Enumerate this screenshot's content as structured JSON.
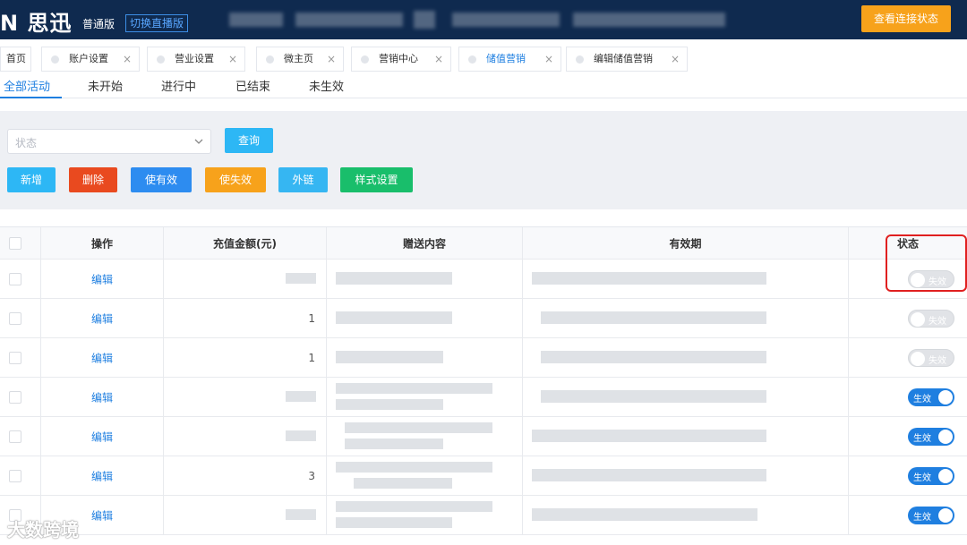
{
  "header": {
    "logo": "N 思迅",
    "edition": "普通版",
    "switch_live": "切换直播版",
    "connection_status_button": "查看连接状态"
  },
  "tabs": [
    {
      "label": "首页"
    },
    {
      "label": "账户设置"
    },
    {
      "label": "营业设置"
    },
    {
      "label": "微主页"
    },
    {
      "label": "营销中心"
    },
    {
      "label": "储值营销"
    },
    {
      "label": "编辑储值营销"
    }
  ],
  "close_glyph": "×",
  "subtabs": [
    {
      "label": "全部活动"
    },
    {
      "label": "未开始"
    },
    {
      "label": "进行中"
    },
    {
      "label": "已结束"
    },
    {
      "label": "未生效"
    }
  ],
  "filter": {
    "status_placeholder": "状态",
    "query_button": "查询"
  },
  "actions": {
    "add": "新增",
    "delete": "删除",
    "activate": "使有效",
    "deactivate": "使失效",
    "external_link": "外链",
    "style_settings": "样式设置"
  },
  "table": {
    "headers": [
      "操作",
      "充值金额(元)",
      "赠送内容",
      "有效期",
      "状态"
    ],
    "rows": [
      {
        "action": "编辑",
        "amount": "",
        "gift": "",
        "validity": "",
        "status": "失效",
        "on": false
      },
      {
        "action": "编辑",
        "amount": "1",
        "gift": "",
        "validity": "",
        "status": "失效",
        "on": false
      },
      {
        "action": "编辑",
        "amount": "1",
        "gift": "",
        "validity": "",
        "status": "失效",
        "on": false
      },
      {
        "action": "编辑",
        "amount": "",
        "gift": "",
        "validity": "",
        "status": "生效",
        "on": true
      },
      {
        "action": "编辑",
        "amount": "",
        "gift": "",
        "validity": "",
        "status": "生效",
        "on": true
      },
      {
        "action": "编辑",
        "amount": "3",
        "gift": "",
        "validity": "",
        "status": "生效",
        "on": true
      },
      {
        "action": "编辑",
        "amount": "",
        "gift": "",
        "validity": "",
        "status": "生效",
        "on": true
      }
    ]
  },
  "watermark": "大数跨境",
  "colors": {
    "header_bg": "#0f2a4f",
    "primary": "#1f7fe0",
    "add": "#2db7f5",
    "delete": "#e94a1f",
    "activate": "#2d8cf0",
    "deactivate": "#f7a21b",
    "external_link": "#36b6f2",
    "style_settings": "#19be6b"
  }
}
